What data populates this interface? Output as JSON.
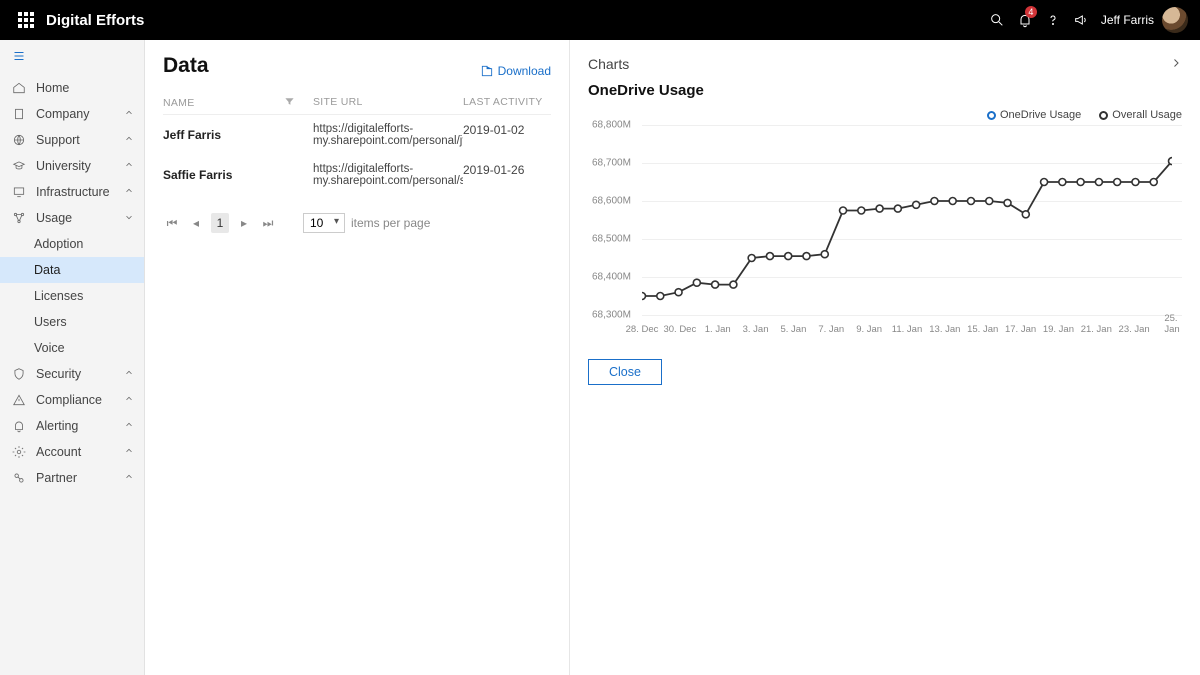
{
  "topbar": {
    "brand": "Digital Efforts",
    "notif_count": "4",
    "username": "Jeff Farris"
  },
  "sidebar": {
    "items": [
      {
        "label": "Home",
        "icon": "home",
        "exp": false,
        "sub": []
      },
      {
        "label": "Company",
        "icon": "building",
        "exp": true,
        "sub": []
      },
      {
        "label": "Support",
        "icon": "globe",
        "exp": true,
        "sub": []
      },
      {
        "label": "University",
        "icon": "grad",
        "exp": true,
        "sub": []
      },
      {
        "label": "Infrastructure",
        "icon": "monitor",
        "exp": true,
        "sub": []
      },
      {
        "label": "Usage",
        "icon": "nodes",
        "exp": true,
        "open": true,
        "sub": [
          {
            "label": "Adoption"
          },
          {
            "label": "Data",
            "active": true
          },
          {
            "label": "Licenses"
          },
          {
            "label": "Users"
          },
          {
            "label": "Voice"
          }
        ]
      },
      {
        "label": "Security",
        "icon": "shield",
        "exp": true,
        "sub": []
      },
      {
        "label": "Compliance",
        "icon": "warn",
        "exp": true,
        "sub": []
      },
      {
        "label": "Alerting",
        "icon": "bell",
        "exp": true,
        "sub": []
      },
      {
        "label": "Account",
        "icon": "gear",
        "exp": true,
        "sub": []
      },
      {
        "label": "Partner",
        "icon": "partner",
        "exp": true,
        "sub": [],
        "color": "#e08a2c"
      }
    ]
  },
  "page": {
    "title": "Data",
    "download": "Download",
    "columns": {
      "name": "NAME",
      "url": "SITE URL",
      "activity": "LAST ACTIVITY"
    },
    "rows": [
      {
        "name": "Jeff Farris",
        "url": "https://digitalefforts-my.sharepoint.com/personal/jfarris...",
        "activity": "2019-01-02"
      },
      {
        "name": "Saffie Farris",
        "url": "https://digitalefforts-my.sharepoint.com/personal/saffie...",
        "activity": "2019-01-26"
      }
    ],
    "pager": {
      "page": "1",
      "size": "10",
      "label": "items per page"
    }
  },
  "panel": {
    "heading": "Charts",
    "title": "OneDrive Usage",
    "legend": [
      "OneDrive Usage",
      "Overall Usage"
    ],
    "close": "Close"
  },
  "chart_data": {
    "type": "line",
    "title": "OneDrive Usage",
    "xlabel": "",
    "ylabel": "",
    "ylim": [
      68300000,
      68800000
    ],
    "yticks": [
      "68,300M",
      "68,400M",
      "68,500M",
      "68,600M",
      "68,700M",
      "68,800M"
    ],
    "xticks": [
      "28. Dec",
      "30. Dec",
      "1. Jan",
      "3. Jan",
      "5. Jan",
      "7. Jan",
      "9. Jan",
      "11. Jan",
      "13. Jan",
      "15. Jan",
      "17. Jan",
      "19. Jan",
      "21. Jan",
      "23. Jan",
      "25. Jan"
    ],
    "series": [
      {
        "name": "Overall Usage",
        "values": [
          {
            "x": "28. Dec",
            "y": 68350000
          },
          {
            "x": "29. Dec",
            "y": 68350000
          },
          {
            "x": "30. Dec",
            "y": 68360000
          },
          {
            "x": "31. Dec",
            "y": 68385000
          },
          {
            "x": "1. Jan",
            "y": 68380000
          },
          {
            "x": "2. Jan",
            "y": 68380000
          },
          {
            "x": "3. Jan",
            "y": 68450000
          },
          {
            "x": "4. Jan",
            "y": 68455000
          },
          {
            "x": "5. Jan",
            "y": 68455000
          },
          {
            "x": "6. Jan",
            "y": 68455000
          },
          {
            "x": "7. Jan",
            "y": 68460000
          },
          {
            "x": "8. Jan",
            "y": 68575000
          },
          {
            "x": "9. Jan",
            "y": 68575000
          },
          {
            "x": "10. Jan",
            "y": 68580000
          },
          {
            "x": "11. Jan",
            "y": 68580000
          },
          {
            "x": "12. Jan",
            "y": 68590000
          },
          {
            "x": "13. Jan",
            "y": 68600000
          },
          {
            "x": "14. Jan",
            "y": 68600000
          },
          {
            "x": "15. Jan",
            "y": 68600000
          },
          {
            "x": "16. Jan",
            "y": 68600000
          },
          {
            "x": "17. Jan",
            "y": 68595000
          },
          {
            "x": "18. Jan",
            "y": 68565000
          },
          {
            "x": "19. Jan",
            "y": 68650000
          },
          {
            "x": "20. Jan",
            "y": 68650000
          },
          {
            "x": "21. Jan",
            "y": 68650000
          },
          {
            "x": "22. Jan",
            "y": 68650000
          },
          {
            "x": "23. Jan",
            "y": 68650000
          },
          {
            "x": "24. Jan",
            "y": 68650000
          },
          {
            "x": "25. Jan",
            "y": 68650000
          },
          {
            "x": "26. Jan",
            "y": 68705000
          }
        ]
      }
    ]
  }
}
